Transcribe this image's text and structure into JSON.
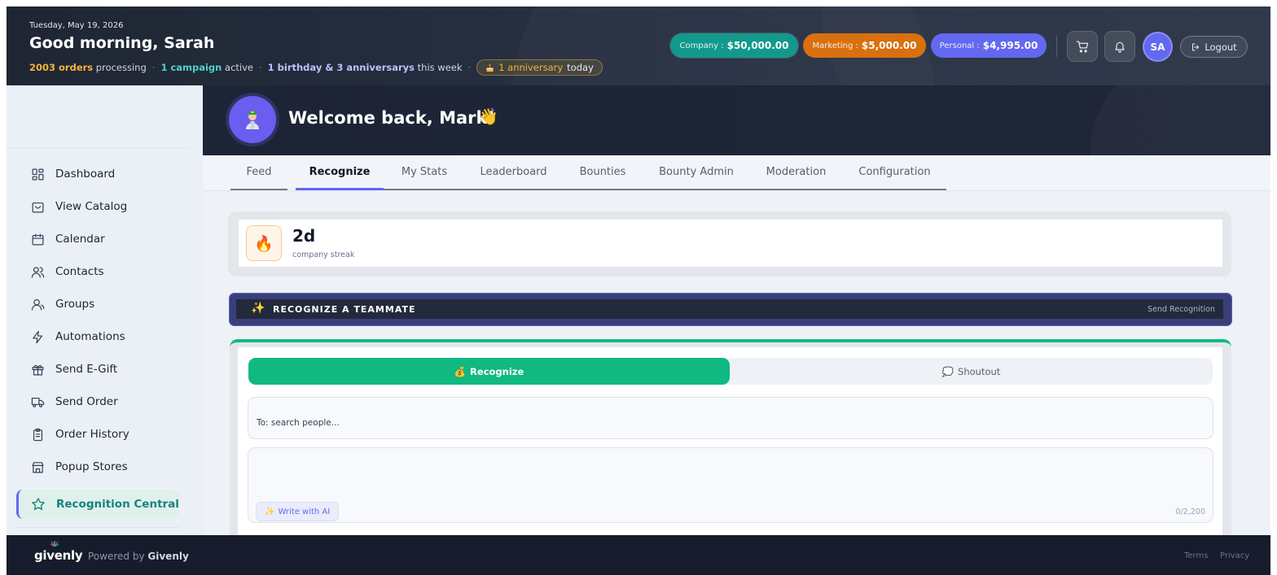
{
  "header": {
    "date": "Tuesday, May 19, 2026",
    "greeting": "Good morning, Sarah",
    "stats": {
      "orders_count": "2003 orders",
      "orders_suffix": "processing",
      "campaign_count": "1 campaign",
      "campaign_suffix": "active",
      "events_count": "1 birthday & 3 anniversarys",
      "events_suffix": "this week",
      "anniversary_count": "1 anniversary",
      "anniversary_suffix": "today",
      "separator": "·"
    },
    "budgets": {
      "company": {
        "label": "Company :",
        "amount": "$50,000.00",
        "color": "#12998c"
      },
      "marketing": {
        "label": "Marketing :",
        "amount": "$5,000.00",
        "color": "#d9700f"
      },
      "personal": {
        "label": "Personal :",
        "amount": "$4,995.00",
        "color": "#6268f0"
      }
    },
    "user_initials": "SA",
    "logout_label": "Logout"
  },
  "sidebar": {
    "items": [
      {
        "label": "Dashboard",
        "icon": "dashboard-icon"
      },
      {
        "label": "View Catalog",
        "icon": "shopping-bag-icon"
      },
      {
        "label": "Calendar",
        "icon": "calendar-icon"
      },
      {
        "label": "Contacts",
        "icon": "contacts-icon"
      },
      {
        "label": "Groups",
        "icon": "groups-icon"
      },
      {
        "label": "Automations",
        "icon": "lightning-icon"
      },
      {
        "label": "Send E-Gift",
        "icon": "gift-icon"
      },
      {
        "label": "Send Order",
        "icon": "truck-icon"
      },
      {
        "label": "Order History",
        "icon": "clipboard-icon"
      },
      {
        "label": "Popup Stores",
        "icon": "store-icon"
      },
      {
        "label": "Recognition Central",
        "icon": "star-icon",
        "active": true
      }
    ]
  },
  "main": {
    "welcome": "Welcome back, Mark!",
    "wave_emoji": "👋",
    "tabs": [
      {
        "label": "Feed"
      },
      {
        "label": "Recognize",
        "active": true
      },
      {
        "label": "My Stats"
      },
      {
        "label": "Leaderboard"
      },
      {
        "label": "Bounties"
      },
      {
        "label": "Bounty Admin"
      },
      {
        "label": "Moderation"
      },
      {
        "label": "Configuration"
      }
    ],
    "streak": {
      "value": "2d",
      "label": "company streak",
      "icon": "🔥"
    },
    "recognize_bar": {
      "title": "RECOGNIZE A TEAMMATE",
      "link": "Send Recognition",
      "icon": "✨"
    },
    "form": {
      "mode_recognize": "Recognize",
      "mode_recognize_icon": "💰",
      "mode_shoutout": "Shoutout",
      "mode_shoutout_icon": "💭",
      "to_placeholder": "To: search people...",
      "ai_button": "Write with AI",
      "ai_icon": "✨",
      "counter": "0/2,200"
    }
  },
  "footer": {
    "logo": "givenly",
    "powered_prefix": "Powered by",
    "powered_brand": "Givenly",
    "terms": "Terms",
    "privacy": "Privacy"
  },
  "colors": {
    "accent": "#6268f0",
    "teal": "#10b981",
    "header_bg": "#1f2633"
  }
}
